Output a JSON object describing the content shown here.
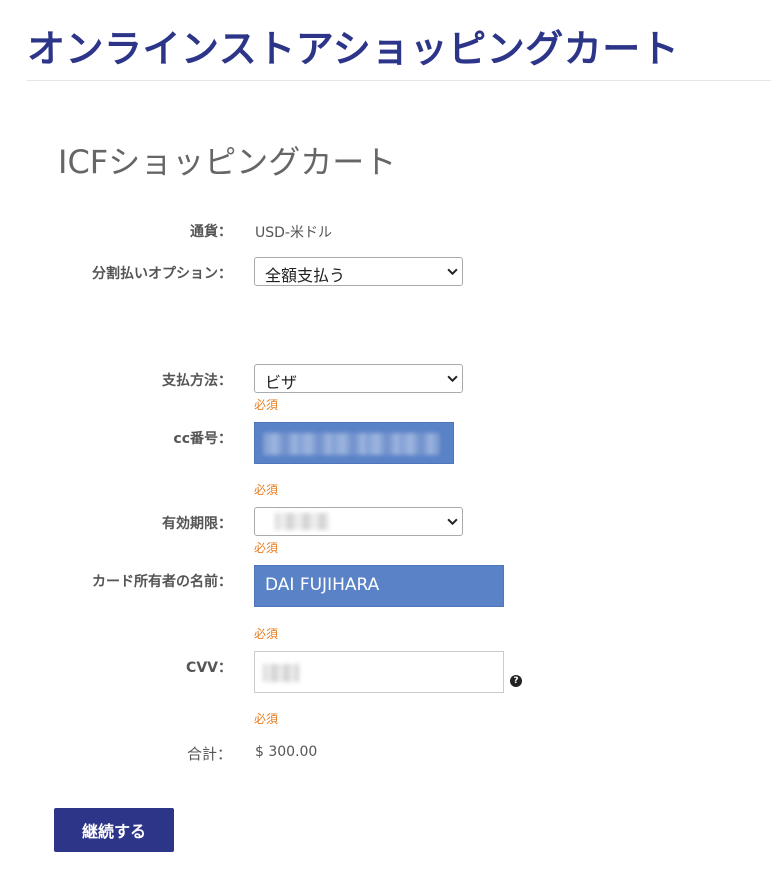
{
  "header": {
    "site_title": "オンラインストアショッピングカート"
  },
  "page": {
    "heading": "ICFショッピングカート"
  },
  "form": {
    "currency": {
      "label": "通貨：",
      "value": "USD-米ドル"
    },
    "installment": {
      "label": "分割払いオプション：",
      "selected": "全額支払う"
    },
    "payment_method": {
      "label": "支払方法：",
      "selected": "ビザ",
      "required": "必須"
    },
    "cc_number": {
      "label": "cc番号：",
      "required": "必須"
    },
    "expiry": {
      "label": "有効期限：",
      "required": "必須"
    },
    "card_holder": {
      "label": "カード所有者の名前：",
      "value": "DAI FUJIHARA",
      "required": "必須"
    },
    "cvv": {
      "label": "CVV：",
      "help": "?",
      "required": "必須"
    },
    "total": {
      "label": "合計：",
      "value": "$ 300.00"
    }
  },
  "actions": {
    "continue_label": "継続する"
  },
  "colors": {
    "brand": "#2d3589",
    "required": "#e67e22",
    "input_fill": "#5a82c6"
  }
}
